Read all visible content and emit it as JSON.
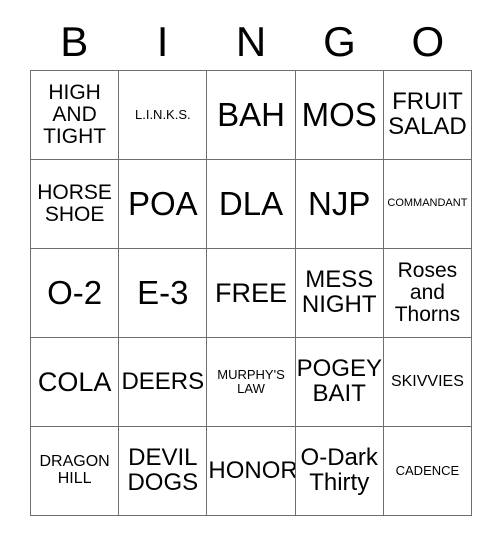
{
  "card": {
    "headers": [
      "B",
      "I",
      "N",
      "G",
      "O"
    ],
    "rows": [
      [
        {
          "text": "HIGH\nAND\nTIGHT",
          "size": "fs-md"
        },
        {
          "text": "L.I.N.K.S.",
          "size": "fs-xs"
        },
        {
          "text": "BAH",
          "size": "fs-xxl"
        },
        {
          "text": "MOS",
          "size": "fs-xxl"
        },
        {
          "text": "FRUIT\nSALAD",
          "size": "fs-lg"
        }
      ],
      [
        {
          "text": "HORSE\nSHOE",
          "size": "fs-md"
        },
        {
          "text": "POA",
          "size": "fs-xxl"
        },
        {
          "text": "DLA",
          "size": "fs-xxl"
        },
        {
          "text": "NJP",
          "size": "fs-xxl"
        },
        {
          "text": "COMMANDANT",
          "size": "fs-xxs"
        }
      ],
      [
        {
          "text": "O-2",
          "size": "fs-xxl"
        },
        {
          "text": "E-3",
          "size": "fs-xxl"
        },
        {
          "text": "FREE",
          "size": "fs-xl"
        },
        {
          "text": "MESS\nNIGHT",
          "size": "fs-lg"
        },
        {
          "text": "Roses\nand\nThorns",
          "size": "fs-md"
        }
      ],
      [
        {
          "text": "COLA",
          "size": "fs-xl"
        },
        {
          "text": "DEERS",
          "size": "fs-lg"
        },
        {
          "text": "MURPHY'S\nLAW",
          "size": "fs-xs"
        },
        {
          "text": "POGEY\nBAIT",
          "size": "fs-lg"
        },
        {
          "text": "SKIVVIES",
          "size": "fs-sm"
        }
      ],
      [
        {
          "text": "DRAGON\nHILL",
          "size": "fs-sm"
        },
        {
          "text": "DEVIL\nDOGS",
          "size": "fs-lg"
        },
        {
          "text": "HONOR",
          "size": "fs-lg"
        },
        {
          "text": "O-Dark\nThirty",
          "size": "fs-lg"
        },
        {
          "text": "CADENCE",
          "size": "fs-xs"
        }
      ]
    ]
  },
  "colors": {
    "background": "#ffffff",
    "text": "#000000",
    "grid_line": "#6e6e6e"
  }
}
